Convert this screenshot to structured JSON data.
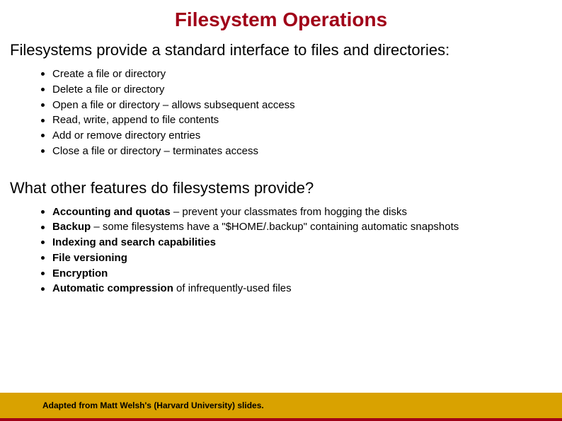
{
  "title": "Filesystem Operations",
  "intro1": "Filesystems provide a standard interface to files and directories:",
  "list1": {
    "i0": "Create a file or directory",
    "i1": "Delete a file or directory",
    "i2": "Open a file or directory – allows subsequent access",
    "i3": "Read, write, append to file contents",
    "i4": "Add or remove directory entries",
    "i5": "Close a file or directory – terminates access"
  },
  "intro2": "What other features do filesystems provide?",
  "list2": {
    "i0b": "Accounting and quotas",
    "i0r": " – prevent your classmates from hogging the disks",
    "i1b": "Backup",
    "i1r": " – some filesystems have a \"$HOME/.backup\" containing automatic snapshots",
    "i2b": "Indexing and search capabilities",
    "i2r": "",
    "i3b": "File versioning",
    "i3r": "",
    "i4b": "Encryption",
    "i4r": "",
    "i5b": "Automatic compression",
    "i5r": " of infrequently-used files"
  },
  "footer": "Adapted from Matt Welsh's (Harvard University) slides."
}
